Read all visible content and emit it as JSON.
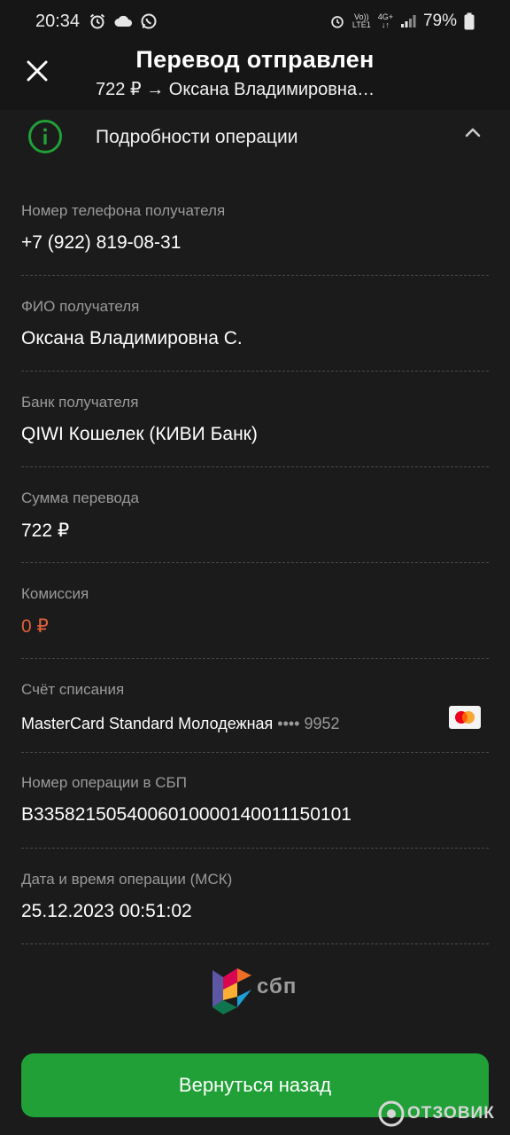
{
  "status_bar": {
    "time": "20:34",
    "left_icons": [
      "alarm-icon",
      "cloud-icon",
      "whatsapp-icon"
    ],
    "network_top": "Vo))",
    "network_bottom": "LTE1",
    "network_type": "4G+",
    "battery": "79%"
  },
  "header": {
    "title": "Перевод отправлен",
    "subtitle": "722 ₽ → Оксана Владимировна…"
  },
  "details": {
    "section_title": "Подробности операции",
    "rows": [
      {
        "label": "Номер телефона получателя",
        "value": "+7 (922) 819-08-31"
      },
      {
        "label": "ФИО получателя",
        "value": "Оксана Владимировна С."
      },
      {
        "label": "Банк получателя",
        "value": "QIWI Кошелек (КИВИ Банк)"
      },
      {
        "label": "Сумма перевода",
        "value": "722 ₽"
      },
      {
        "label": "Комиссия",
        "value": "0 ₽"
      },
      {
        "label": "Счёт списания",
        "value": "MasterCard Standard Молодежная",
        "card_mask": "•••• 9952"
      },
      {
        "label": "Номер операции в СБП",
        "value": "B3358215054006010000140011150101"
      },
      {
        "label": "Дата и время операции (МСК)",
        "value": "25.12.2023 00:51:02"
      }
    ]
  },
  "sbp_logo_text": "сбп",
  "back_button_label": "Вернуться назад",
  "watermark_text": "ОТЗОВИК",
  "colors": {
    "background": "#1b1b1b",
    "accent_green": "#21a038",
    "commission_orange": "#e2603b"
  }
}
